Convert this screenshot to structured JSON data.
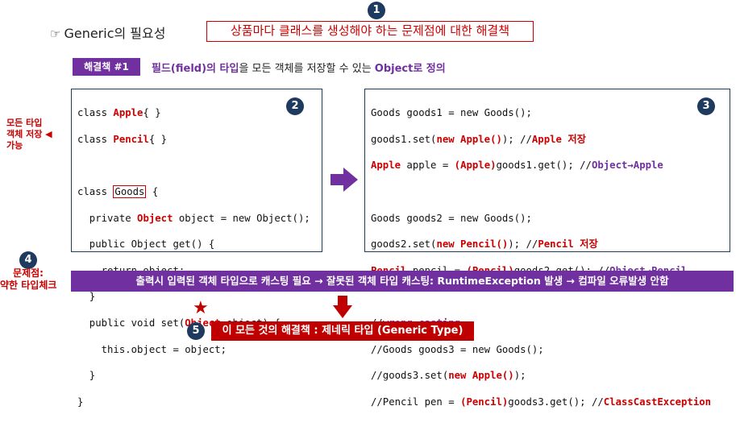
{
  "badges": {
    "b1": "1",
    "b2": "2",
    "b3": "3",
    "b4": "4",
    "b5": "5"
  },
  "header": {
    "title": "Generic의 필요성",
    "hand_icon": "pointing-hand-icon",
    "problem": "상품마다 클래스를 생성해야 하는 문제점에 대한 해결책"
  },
  "solution": {
    "label": "해결책  #1",
    "text_a": "필드(field)의 타입",
    "text_b": "을 모든 객체를 저장할 수 있는 ",
    "text_c": "Object로 정의"
  },
  "side_note": [
    "모든 타입",
    "객체 저장",
    "가능"
  ],
  "left_code": {
    "l1a": "class ",
    "l1b": "Apple",
    "l1c": "{ }",
    "l2a": "class ",
    "l2b": "Pencil",
    "l2c": "{ }",
    "l3a": "class ",
    "l3b": "Goods",
    "l3c": " {",
    "l4a": "  private ",
    "l4b": "Object",
    "l4c": " object = new Object();",
    "l5": "  public Object get() {",
    "l6": "    return object;",
    "l7": "  }",
    "l8a": "  public void set(",
    "l8b": "Object",
    "l8c": " object) {",
    "l9": "    this.object = object;",
    "l10": "  }",
    "l11": "}"
  },
  "right_code": {
    "r1": "Goods goods1 = new Goods();",
    "r2a": "goods1.set(",
    "r2b": "new Apple()",
    "r2c": "); //",
    "r2d": "Apple 저장",
    "r3a": "Apple",
    "r3b": " apple = ",
    "r3c": "(Apple)",
    "r3d": "goods1.get(); //",
    "r3e": "Object→Apple",
    "r4": "Goods goods2 = new Goods();",
    "r5a": "goods2.set(",
    "r5b": "new Pencil()",
    "r5c": "); //",
    "r5d": "Pencil 저장",
    "r6a": "Pencil",
    "r6b": " pencil = ",
    "r6c": "(Pencil)",
    "r6d": "goods2.get(); //",
    "r6e": "Object→Pencil",
    "r7a": "//",
    "r7b": "wrong casting",
    "r8": "//Goods goods3 = new Goods();",
    "r9a": "//goods3.set(",
    "r9b": "new Apple()",
    "r9c": ");",
    "r10a": "//Pencil pen = ",
    "r10b": "(Pencil)",
    "r10c": "goods3.get(); //",
    "r10d": "ClassCastException"
  },
  "problem_label": [
    "문제점:",
    "약한 타입체크"
  ],
  "bar_text": "출력시 입력된 객체 타입으로 캐스팅 필요 → 잘못된 객체 타입 캐스팅: RuntimeException 발생 → 컴파일 오류발생 안함",
  "answer_text": "이 모든 것의 해결책 : 제네릭 타입 (Generic Type)",
  "colors": {
    "purple": "#7030a0",
    "red": "#cc0000",
    "navy": "#1f3a5f",
    "dark_red": "#c00000"
  }
}
